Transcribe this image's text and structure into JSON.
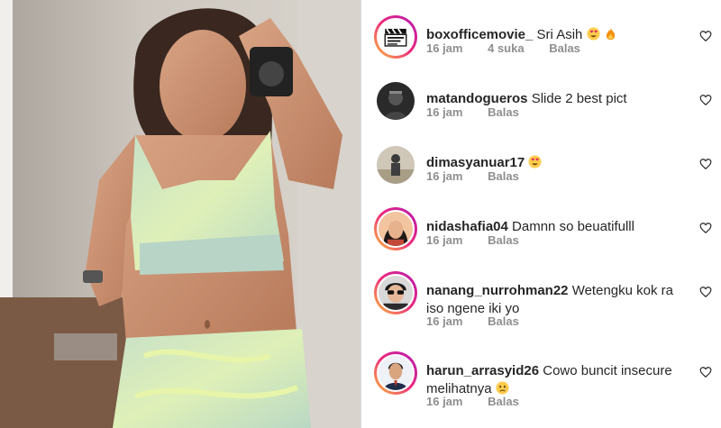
{
  "comments": [
    {
      "username": "boxofficemovie_",
      "text": "Sri Asih",
      "emojis": [
        "heart-eyes-emoji",
        "fire-emoji"
      ],
      "time": "16 jam",
      "likes": "4 suka",
      "reply": "Balas",
      "avatar": "clapperboard-logo",
      "story_ring": true
    },
    {
      "username": "matandogueros",
      "text": "Slide 2 best pict",
      "emojis": [],
      "time": "16 jam",
      "likes": "",
      "reply": "Balas",
      "avatar": "dark-photo",
      "story_ring": false
    },
    {
      "username": "dimasyanuar17",
      "text": "",
      "emojis": [
        "heart-eyes-emoji"
      ],
      "time": "16 jam",
      "likes": "",
      "reply": "Balas",
      "avatar": "outdoor-photo",
      "story_ring": false
    },
    {
      "username": "nidashafia04",
      "text": "Damnn so beuatifulll",
      "emojis": [],
      "time": "16 jam",
      "likes": "",
      "reply": "Balas",
      "avatar": "portrait-woman",
      "story_ring": true
    },
    {
      "username": "nanang_nurrohman22",
      "text": "Wetengku kok ra iso ngene iki yo",
      "emojis": [],
      "time": "16 jam",
      "likes": "",
      "reply": "Balas",
      "avatar": "portrait-sunglasses",
      "story_ring": true
    },
    {
      "username": "harun_arrasyid26",
      "text": "Cowo buncit insecure melihatnya",
      "emojis": [
        "sad-emoji"
      ],
      "time": "16 jam",
      "likes": "",
      "reply": "Balas",
      "avatar": "portrait-man",
      "story_ring": true
    }
  ],
  "colors": {
    "meta_text": "#8e8e8e",
    "username": "#262626",
    "ring_start": "#f9c33b",
    "ring_end": "#b31bb5"
  }
}
